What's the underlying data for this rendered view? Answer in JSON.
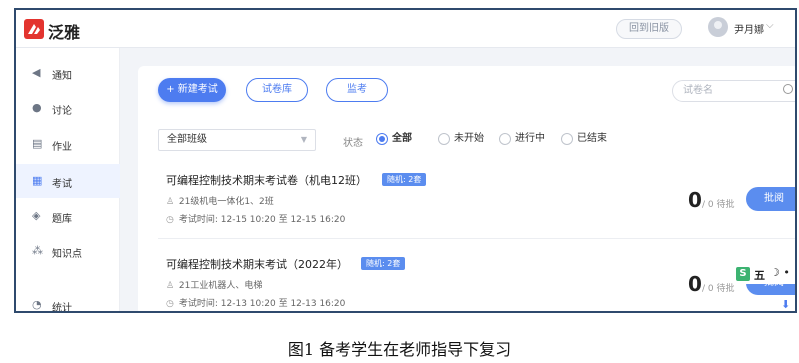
{
  "header": {
    "brand": "泛雅",
    "old_version_label": "回到旧版",
    "username": "尹月娜"
  },
  "sidebar": {
    "items": [
      {
        "label": "通知",
        "icon": "speaker-icon"
      },
      {
        "label": "讨论",
        "icon": "chat-icon"
      },
      {
        "label": "作业",
        "icon": "homework-icon"
      },
      {
        "label": "考试",
        "icon": "exam-icon",
        "active": true
      },
      {
        "label": "题库",
        "icon": "question-bank-icon"
      },
      {
        "label": "知识点",
        "icon": "knowledge-icon"
      },
      {
        "label": "统计",
        "icon": "stats-icon"
      }
    ]
  },
  "toolbar": {
    "new_exam": "+ 新建考试",
    "paper_bank": "试卷库",
    "proctor": "监考",
    "search_placeholder": "试卷名"
  },
  "filters": {
    "class_select": "全部班级",
    "status_label": "状态",
    "options": [
      "全部",
      "未开始",
      "进行中",
      "已结束"
    ],
    "selected": "全部"
  },
  "exams": [
    {
      "title": "可编程控制技术期末考试卷（机电12班）",
      "badge": "随机: 2套",
      "classes": "21级机电一体化1、2班",
      "time": "考试时间: 12-15 10:20 至 12-15 16:20",
      "pending": "0",
      "total_text": "/ 0 待批",
      "action": "批阅"
    },
    {
      "title": "可编程控制技术期末考试（2022年）",
      "badge": "随机: 2套",
      "classes": "21工业机器人、电梯",
      "time": "考试时间: 12-13 10:20 至 12-13 16:20",
      "pending": "0",
      "total_text": "/ 0 待批",
      "action": "批阅"
    }
  ],
  "ime": {
    "label": "五"
  },
  "caption": "图1 备考学生在老师指导下复习",
  "colors": {
    "accent": "#4d7cf0",
    "frame": "#2f4a6d"
  }
}
